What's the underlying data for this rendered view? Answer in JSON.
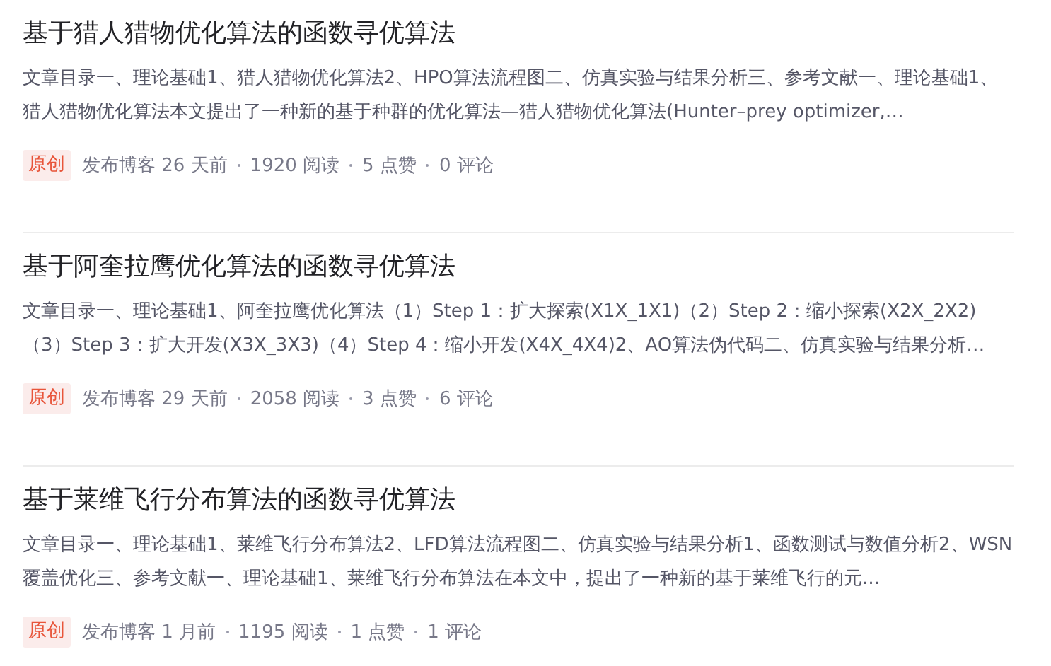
{
  "articles": [
    {
      "title": "基于猎人猎物优化算法的函数寻优算法",
      "excerpt": "文章目录一、理论基础1、猎人猎物优化算法2、HPO算法流程图二、仿真实验与结果分析三、参考文献一、理论基础1、猎人猎物优化算法本文提出了一种新的基于种群的优化算法—猎人猎物优化算法(Hunter–prey optimizer,…",
      "badge": "原创",
      "meta": [
        "发布博客 26 天前",
        "1920 阅读",
        "5 点赞",
        "0 评论"
      ]
    },
    {
      "title": "基于阿奎拉鹰优化算法的函数寻优算法",
      "excerpt": "文章目录一、理论基础1、阿奎拉鹰优化算法（1）Step 1：扩大探索(X1X_1X1)（2）Step 2：缩小探索(X2X_2X2)（3）Step 3：扩大开发(X3X_3X3)（4）Step 4：缩小开发(X4X_4X4)2、AO算法伪代码二、仿真实验与结果分析…",
      "badge": "原创",
      "meta": [
        "发布博客 29 天前",
        "2058 阅读",
        "3 点赞",
        "6 评论"
      ]
    },
    {
      "title": "基于莱维飞行分布算法的函数寻优算法",
      "excerpt": "文章目录一、理论基础1、莱维飞行分布算法2、LFD算法流程图二、仿真实验与结果分析1、函数测试与数值分析2、WSN覆盖优化三、参考文献一、理论基础1、莱维飞行分布算法在本文中，提出了一种新的基于莱维飞行的元…",
      "badge": "原创",
      "meta": [
        "发布博客 1 月前",
        "1195 阅读",
        "1 点赞",
        "1 评论"
      ]
    }
  ]
}
